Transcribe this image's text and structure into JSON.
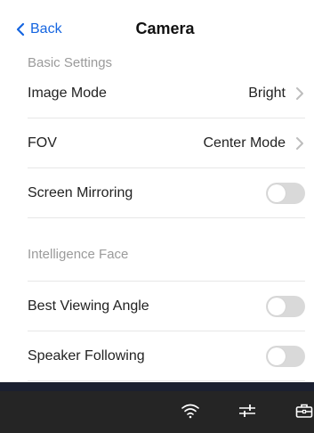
{
  "header": {
    "back_label": "Back",
    "title": "Camera"
  },
  "sections": {
    "basic": "Basic Settings",
    "intelligence": "Intelligence Face"
  },
  "rows": [
    {
      "label": "Image Mode",
      "value": "Bright"
    },
    {
      "label": "FOV",
      "value": "Center Mode"
    },
    {
      "label": "Screen Mirroring",
      "toggle": false
    },
    {
      "label": "Best Viewing Angle",
      "toggle": false
    },
    {
      "label": "Speaker Following",
      "toggle": false
    }
  ],
  "colors": {
    "accent": "#1565e0",
    "toggle_off": "#d9d9d9",
    "bottom_bar": "#252525"
  },
  "bottom_bar": {
    "icons": [
      "wifi-icon",
      "sliders-icon",
      "toolbox-icon"
    ]
  }
}
